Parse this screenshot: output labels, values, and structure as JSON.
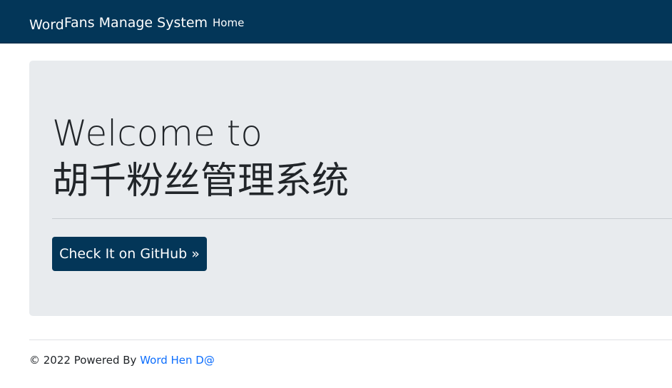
{
  "navbar": {
    "brand_prefix": "Word",
    "brand_rest": "Fans Manage System",
    "home_label": "Home"
  },
  "hero": {
    "line1": "Welcome to",
    "line2": "胡千粉丝管理系统",
    "button_label": "Check It on GitHub »"
  },
  "footer": {
    "text": "© 2022 Powered By ",
    "link_label": "Word Hen D@"
  },
  "colors": {
    "navbar_bg": "#033658",
    "jumbotron_bg": "#e8ebee",
    "button_bg": "#033658",
    "link": "#0d6efd"
  }
}
